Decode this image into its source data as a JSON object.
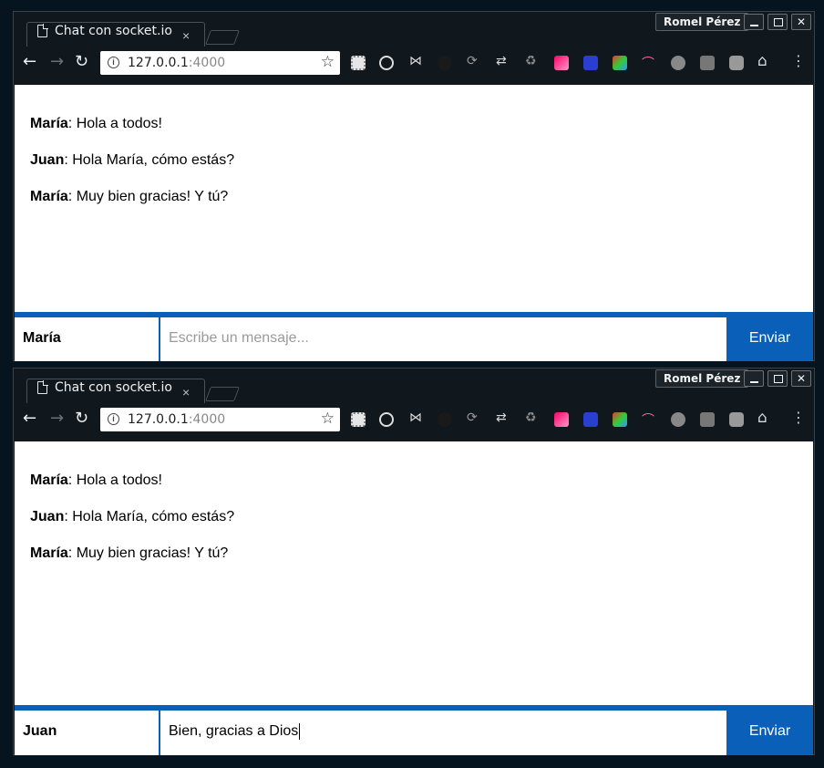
{
  "windows": [
    {
      "profile_name": "Romel Pérez",
      "tab_title": "Chat con socket.io",
      "tab_close": "×",
      "url_host": "127.0.0.1",
      "url_port": ":4000",
      "messages": [
        {
          "user": "María",
          "text": ": Hola a todos!"
        },
        {
          "user": "Juan",
          "text": ": Hola María, cómo estás?"
        },
        {
          "user": "María",
          "text": ": Muy bien gracias! Y tú?"
        }
      ],
      "form": {
        "username": "María",
        "message_value": "",
        "message_placeholder": "Escribe un mensaje...",
        "send_label": "Enviar"
      }
    },
    {
      "profile_name": "Romel Pérez",
      "tab_title": "Chat con socket.io",
      "tab_close": "×",
      "url_host": "127.0.0.1",
      "url_port": ":4000",
      "messages": [
        {
          "user": "María",
          "text": ": Hola a todos!"
        },
        {
          "user": "Juan",
          "text": ": Hola María, cómo estás?"
        },
        {
          "user": "María",
          "text": ": Muy bien gracias! Y tú?"
        }
      ],
      "form": {
        "username": "Juan",
        "message_value": "Bien, gracias a Dios",
        "message_placeholder": "Escribe un mensaje...",
        "send_label": "Enviar"
      }
    }
  ],
  "icons": {
    "back": "back-arrow-icon",
    "forward": "forward-arrow-icon",
    "reload": "reload-icon",
    "info": "info-icon",
    "bookmark": "bookmark-star-icon",
    "extensions": [
      "extension-grid-icon",
      "extension-target-icon",
      "extension-bowtie-icon",
      "extension-dark-icon",
      "extension-sync-icon",
      "extension-refresh-icon",
      "extension-recycle-icon",
      "extension-pink-icon",
      "extension-blue-icon",
      "extension-s-icon",
      "extension-rainbow-icon",
      "extension-power-icon",
      "extension-zero-icon",
      "extension-gray-icon",
      "home-icon",
      "menu-dots-icon"
    ]
  },
  "colors": {
    "accent": "#0a60b8",
    "frame": "#10171d",
    "desktop": "#061420"
  }
}
